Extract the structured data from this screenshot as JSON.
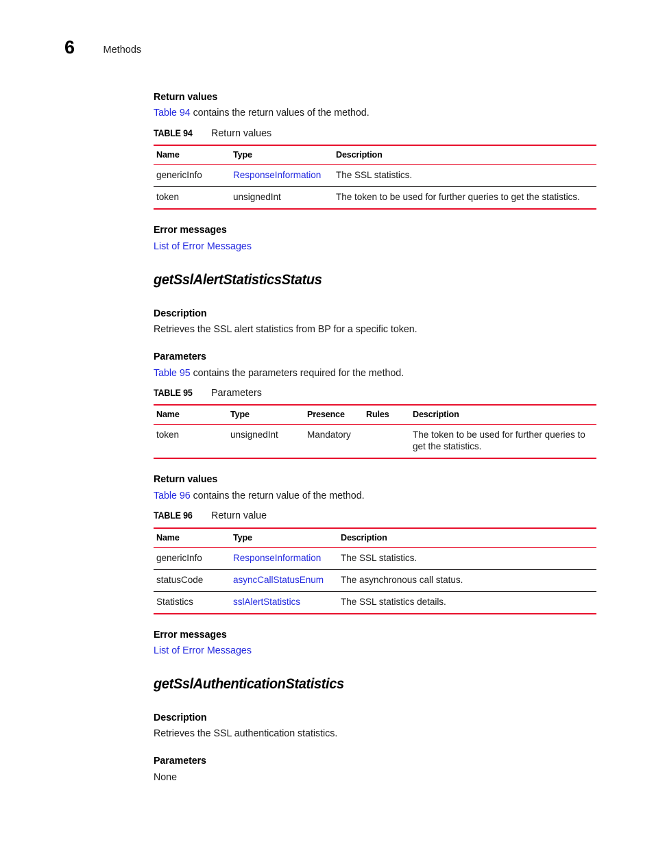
{
  "page": {
    "chapter_number": "6",
    "chapter_title": "Methods"
  },
  "colors": {
    "link": "#2329e0",
    "table_rule_accent": "#e8112d",
    "table_rule_inner": "#231f20",
    "text": "#1a1a1a"
  },
  "sections": {
    "return_values_1": {
      "heading": "Return values",
      "intro_link": "Table 94",
      "intro_rest": " contains the return values of the method."
    },
    "error_messages_1": {
      "heading": "Error messages",
      "link": "List of Error Messages"
    },
    "method_1": {
      "title": "getSslAlertStatisticsStatus",
      "description_heading": "Description",
      "description_text": "Retrieves the SSL alert statistics from BP for a specific token.",
      "parameters_heading": "Parameters",
      "parameters_intro_link": "Table 95",
      "parameters_intro_rest": " contains the parameters required for the method."
    },
    "return_values_2": {
      "heading": "Return values",
      "intro_link": "Table 96",
      "intro_rest": " contains the return value of the method."
    },
    "error_messages_2": {
      "heading": "Error messages",
      "link": "List of Error Messages"
    },
    "method_2": {
      "title": "getSslAuthenticationStatistics",
      "description_heading": "Description",
      "description_text": "Retrieves the SSL authentication statistics.",
      "parameters_heading": "Parameters",
      "parameters_value": "None"
    }
  },
  "tables": {
    "table94": {
      "label": "TABLE 94",
      "caption": "Return values",
      "columns": [
        "Name",
        "Type",
        "Description"
      ],
      "rows": [
        {
          "name": "genericInfo",
          "type": "ResponseInformation",
          "type_is_link": true,
          "description": "The SSL statistics."
        },
        {
          "name": "token",
          "type": "unsignedInt",
          "type_is_link": false,
          "description": "The token to be used for further queries to get the statistics."
        }
      ]
    },
    "table95": {
      "label": "TABLE 95",
      "caption": "Parameters",
      "columns": [
        "Name",
        "Type",
        "Presence",
        "Rules",
        "Description"
      ],
      "rows": [
        {
          "name": "token",
          "type": "unsignedInt",
          "presence": "Mandatory",
          "rules": "",
          "description": "The token to be used for further queries to get the statistics."
        }
      ]
    },
    "table96": {
      "label": "TABLE 96",
      "caption": "Return value",
      "columns": [
        "Name",
        "Type",
        "Description"
      ],
      "rows": [
        {
          "name": "genericInfo",
          "type": "ResponseInformation",
          "type_is_link": true,
          "description": "The SSL statistics."
        },
        {
          "name": "statusCode",
          "type": "asyncCallStatusEnum",
          "type_is_link": true,
          "description": "The asynchronous call status."
        },
        {
          "name": "Statistics",
          "type": "sslAlertStatistics",
          "type_is_link": true,
          "description": "The SSL statistics details."
        }
      ]
    }
  }
}
